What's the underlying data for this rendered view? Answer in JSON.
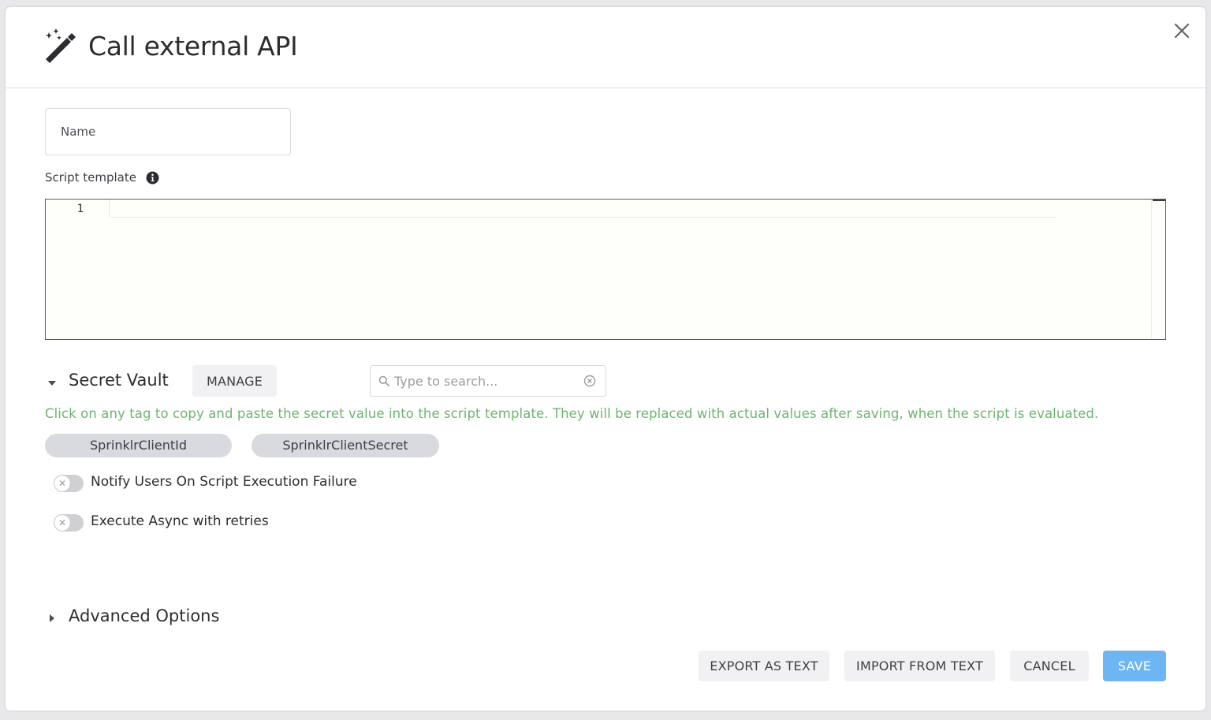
{
  "dialog": {
    "title": "Call external API",
    "title_icon": "magic-wand-icon",
    "close_icon": "close-icon"
  },
  "form": {
    "name_placeholder": "Name",
    "name_value": "",
    "script_label": "Script template",
    "script_info_icon": "info-icon",
    "editor": {
      "line_numbers": [
        "1"
      ],
      "content": ""
    }
  },
  "secret_vault": {
    "title": "Secret Vault",
    "expanded": true,
    "manage_label": "MANAGE",
    "search_placeholder": "Type to search...",
    "hint": "Click on any tag to copy and paste the secret value into the script template. They will be replaced with actual values after saving, when the script is evaluated.",
    "tags": [
      "SprinklrClientId",
      "SprinklrClientSecret"
    ]
  },
  "toggles": [
    {
      "label": "Notify Users On Script Execution Failure",
      "on": false
    },
    {
      "label": "Execute Async with retries",
      "on": false
    }
  ],
  "advanced": {
    "title": "Advanced Options",
    "expanded": false
  },
  "footer": {
    "export_label": "EXPORT AS TEXT",
    "import_label": "IMPORT FROM TEXT",
    "cancel_label": "CANCEL",
    "save_label": "SAVE"
  },
  "colors": {
    "hint_green": "#6cb56f",
    "save_blue": "#6eb6f3",
    "tag_bg": "#d9dae0"
  }
}
